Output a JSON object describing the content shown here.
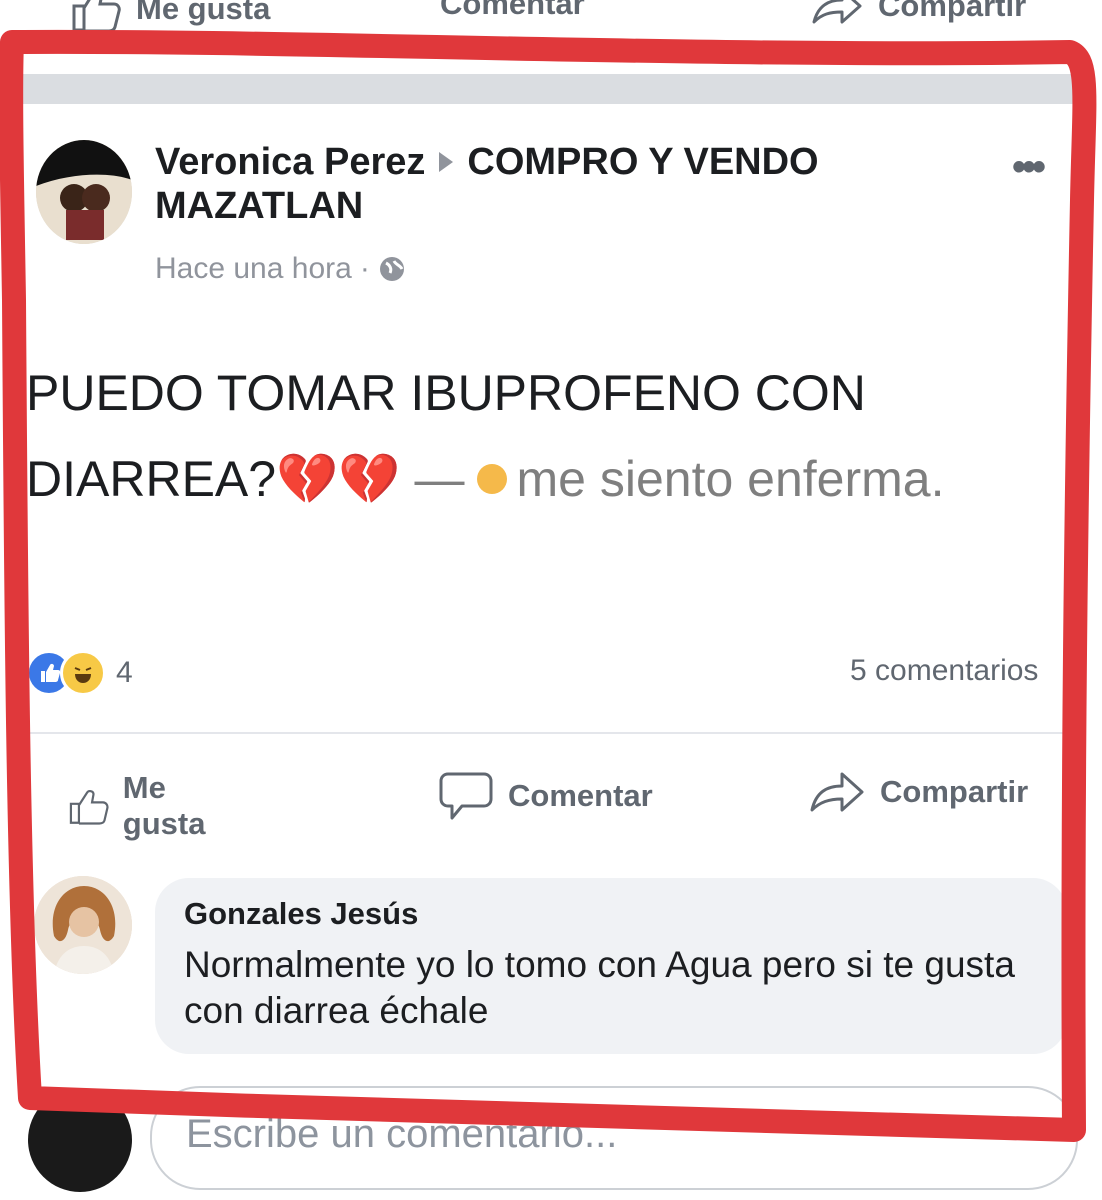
{
  "top_actions": {
    "like": "Me gusta",
    "comment": "Comentar",
    "share": "Compartir"
  },
  "post": {
    "author": "Veronica Perez",
    "group": "COMPRO Y VENDO MAZATLAN",
    "timestamp": "Hace una hora",
    "text": "PUEDO TOMAR IBUPROFENO CON DIARREA?",
    "emojis": "💔💔",
    "dash": "—",
    "feeling": "me siento enferma.",
    "reaction_count": "4",
    "comments_count": "5 comentarios",
    "more": "•••"
  },
  "actions": {
    "like": "Me gusta",
    "comment": "Comentar",
    "share": "Compartir"
  },
  "comment": {
    "author": "Gonzales Jesús",
    "text": "Normalmente yo lo tomo con Agua pero  si te gusta con diarrea échale"
  },
  "write_comment": {
    "placeholder": "Escribe un comentario..."
  },
  "colors": {
    "frame": "#e0383b",
    "like_blue": "#3b78e7",
    "text_gray": "#606770"
  },
  "icons": [
    "like-icon",
    "comment-icon",
    "share-icon",
    "globe-icon",
    "broken-heart-icon",
    "haha-reaction-icon",
    "more-icon"
  ]
}
